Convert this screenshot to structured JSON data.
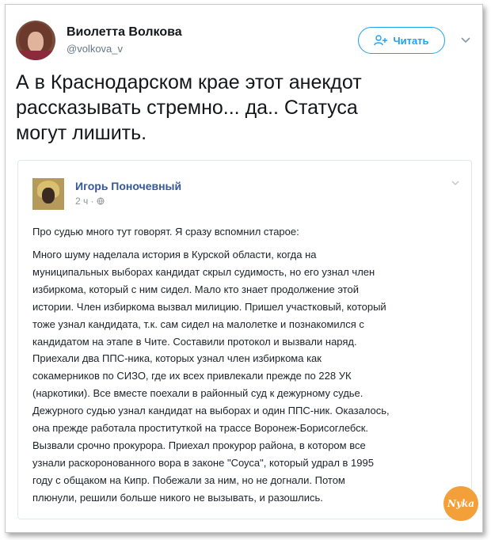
{
  "tweet": {
    "author_name": "Виолетта Волкова",
    "author_handle": "@volkova_v",
    "follow_label": "Читать",
    "text": "А в Краснодарском крае этот анекдот\nрассказывать стремно... да..  Статуса\nмогут лишить."
  },
  "embedded_post": {
    "author_name": "Игорь Поночевный",
    "time": "2 ч ·",
    "intro": "Про судью много тут говорят. Я сразу вспомнил старое:",
    "body": "Много шуму наделала история в Курской области, когда на\nмуниципальных выборах кандидат скрыл судимость, но его узнал член\nизбиркома, который с ним сидел. Мало кто знает продолжение этой\nистории. Член избиркома вызвал милицию. Пришел участковый, который\nтоже узнал кандидата, т.к. сам сидел на малолетке и познакомился с\nкандидатом на этапе в Чите. Составили протокол и вызвали наряд.\nПриехали два ППС-ника, которых узнал член избиркома как\nсокамерников по СИЗО, где их всех привлекали прежде по 228 УК\n(наркотики). Все вместе поехали в районный суд к дежурному судье.\nДежурного судью узнал кандидат на выборах и один ППС-ник. Оказалось,\nона прежде работала проституткой на трассе Воронеж-Борисоглебск.\nВызвали срочно прокурора. Приехал прокурор района, в котором все\nузнали раскоронованного вора в законе \"Соуса\", который удрал в 1995\nгоду с общаком на Кипр. Побежали за ним, но не догнали. Потом\nплюнули, решили больше никого не вызывать, и разошлись."
  },
  "watermark": "Nyka",
  "colors": {
    "accent": "#1da1f2",
    "fb_name": "#365899",
    "logo": "#f3a03a"
  }
}
